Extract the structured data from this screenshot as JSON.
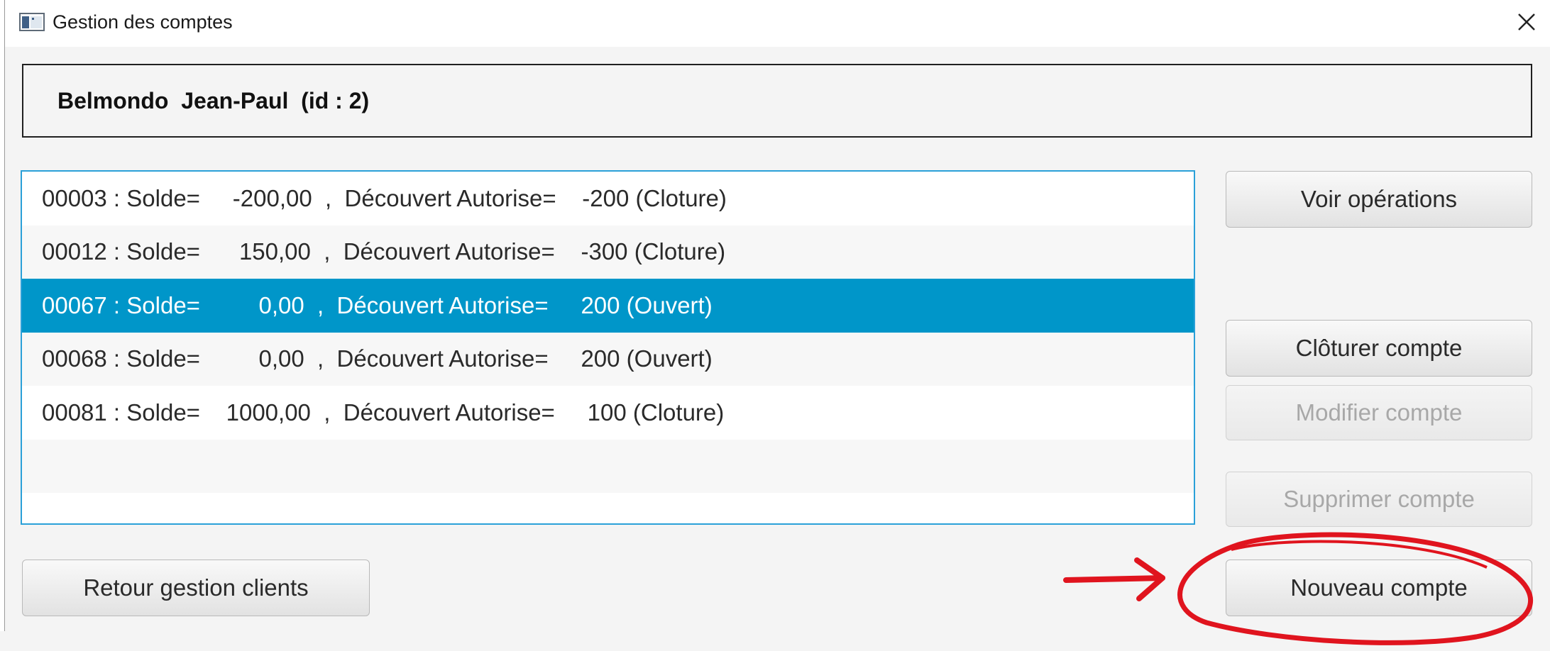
{
  "window": {
    "title": "Gestion des comptes"
  },
  "header": {
    "client_text": "Belmondo  Jean-Paul  (id : 2)"
  },
  "accounts": [
    {
      "text": "00003 : Solde=     -200,00  ,  Découvert Autorise=    -200 (Cloture)"
    },
    {
      "text": "00012 : Solde=      150,00  ,  Découvert Autorise=    -300 (Cloture)"
    },
    {
      "text": "00067 : Solde=         0,00  ,  Découvert Autorise=     200 (Ouvert)"
    },
    {
      "text": "00068 : Solde=         0,00  ,  Découvert Autorise=     200 (Ouvert)"
    },
    {
      "text": "00081 : Solde=    1000,00  ,  Découvert Autorise=     100 (Cloture)"
    }
  ],
  "selected_account_index": 2,
  "buttons": {
    "voir_operations": "Voir opérations",
    "cloturer": "Clôturer compte",
    "modifier": "Modifier compte",
    "supprimer": "Supprimer compte",
    "nouveau": "Nouveau compte",
    "retour": "Retour gestion clients"
  },
  "colors": {
    "selection": "#0096c9",
    "list_border": "#2aa0d8",
    "annotation": "#e0141e"
  },
  "icons": {
    "app": "app-window-icon",
    "close": "close-icon",
    "arrow": "red-arrow-annotation"
  }
}
